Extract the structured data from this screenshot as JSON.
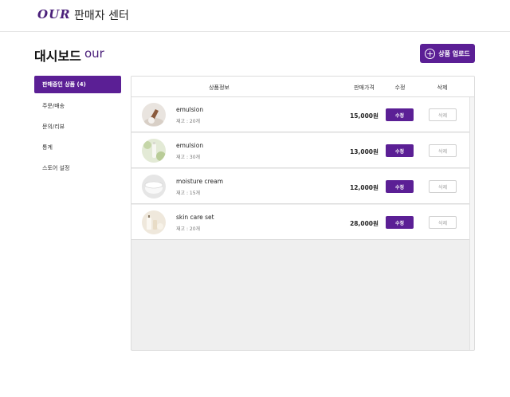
{
  "header": {
    "logo": "OUR",
    "title": "판매자 센터"
  },
  "dashboard": {
    "title": "대시보드",
    "brand": "our",
    "upload_label": "상품 업로드"
  },
  "sidebar": {
    "items": [
      {
        "label": "판매중인 상품 (4)",
        "active": true
      },
      {
        "label": "주문/배송",
        "active": false
      },
      {
        "label": "문의/리뷰",
        "active": false
      },
      {
        "label": "통계",
        "active": false
      },
      {
        "label": "스토어 설정",
        "active": false
      }
    ]
  },
  "table": {
    "columns": [
      "상품정보",
      "판매가격",
      "수정",
      "삭제"
    ],
    "edit_label": "수정",
    "delete_label": "삭제",
    "rows": [
      {
        "name": "emulsion",
        "stock": "재고 : 20개",
        "price": "15,000원"
      },
      {
        "name": "emulsion",
        "stock": "재고 : 30개",
        "price": "13,000원"
      },
      {
        "name": "moisture cream",
        "stock": "재고 : 15개",
        "price": "12,000원"
      },
      {
        "name": "skin care set",
        "stock": "재고 : 20개",
        "price": "28,000원"
      }
    ]
  },
  "colors": {
    "accent": "#5b1f95",
    "brand": "#4a1f7a"
  }
}
